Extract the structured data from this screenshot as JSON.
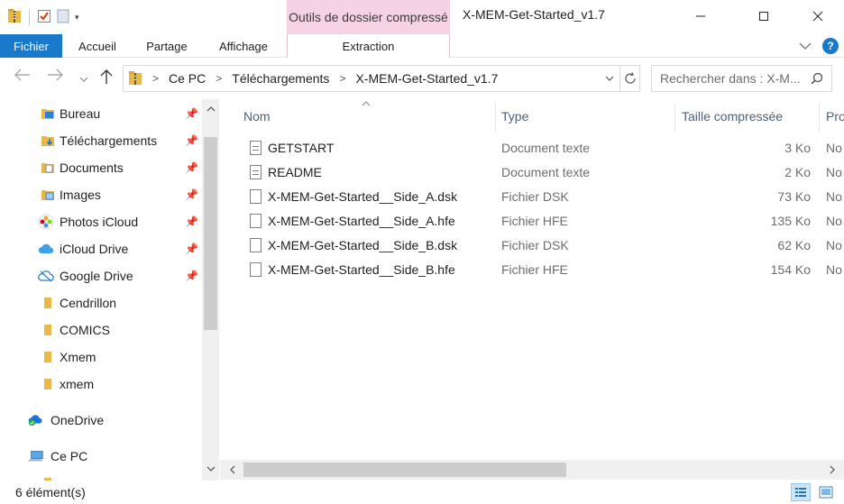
{
  "window": {
    "title": "X-MEM-Get-Started_v1.7",
    "context_group": "Outils de dossier compressé"
  },
  "ribbon": {
    "tabs": [
      {
        "label": "Fichier"
      },
      {
        "label": "Accueil"
      },
      {
        "label": "Partage"
      },
      {
        "label": "Affichage"
      },
      {
        "label": "Extraction"
      }
    ],
    "help": "?"
  },
  "address": {
    "crumbs": [
      "Ce PC",
      "Téléchargements",
      "X-MEM-Get-Started_v1.7"
    ],
    "search_placeholder": "Rechercher dans : X-M..."
  },
  "sidebar": {
    "items": [
      {
        "label": "Bureau",
        "icon": "desktop-folder-icon"
      },
      {
        "label": "Téléchargements",
        "icon": "downloads-folder-icon"
      },
      {
        "label": "Documents",
        "icon": "documents-folder-icon"
      },
      {
        "label": "Images",
        "icon": "images-folder-icon"
      },
      {
        "label": "Photos iCloud",
        "icon": "icloud-photos-icon"
      },
      {
        "label": "iCloud Drive",
        "icon": "icloud-drive-icon"
      },
      {
        "label": "Google Drive",
        "icon": "google-drive-icon"
      },
      {
        "label": "Cendrillon",
        "icon": "folder-icon"
      },
      {
        "label": "COMICS",
        "icon": "folder-icon"
      },
      {
        "label": "Xmem",
        "icon": "folder-icon"
      },
      {
        "label": "xmem",
        "icon": "folder-icon"
      },
      {
        "label": "OneDrive",
        "icon": "onedrive-icon"
      },
      {
        "label": "Ce PC",
        "icon": "this-pc-icon"
      }
    ]
  },
  "list": {
    "columns": [
      "Nom",
      "Type",
      "Taille compressée",
      "Pro"
    ],
    "rows": [
      {
        "name": "GETSTART",
        "type": "Document texte",
        "size": "3 Ko",
        "prot": "No"
      },
      {
        "name": "README",
        "type": "Document texte",
        "size": "2 Ko",
        "prot": "No"
      },
      {
        "name": "X-MEM-Get-Started__Side_A.dsk",
        "type": "Fichier DSK",
        "size": "73 Ko",
        "prot": "No"
      },
      {
        "name": "X-MEM-Get-Started__Side_A.hfe",
        "type": "Fichier HFE",
        "size": "135 Ko",
        "prot": "No"
      },
      {
        "name": "X-MEM-Get-Started__Side_B.dsk",
        "type": "Fichier DSK",
        "size": "62 Ko",
        "prot": "No"
      },
      {
        "name": "X-MEM-Get-Started__Side_B.hfe",
        "type": "Fichier HFE",
        "size": "154 Ko",
        "prot": "No"
      }
    ]
  },
  "status": {
    "count": "6 élément(s)"
  },
  "colors": {
    "accent": "#1979ca",
    "context_tab": "#f6d3e4",
    "folder": "#e8b84a"
  }
}
